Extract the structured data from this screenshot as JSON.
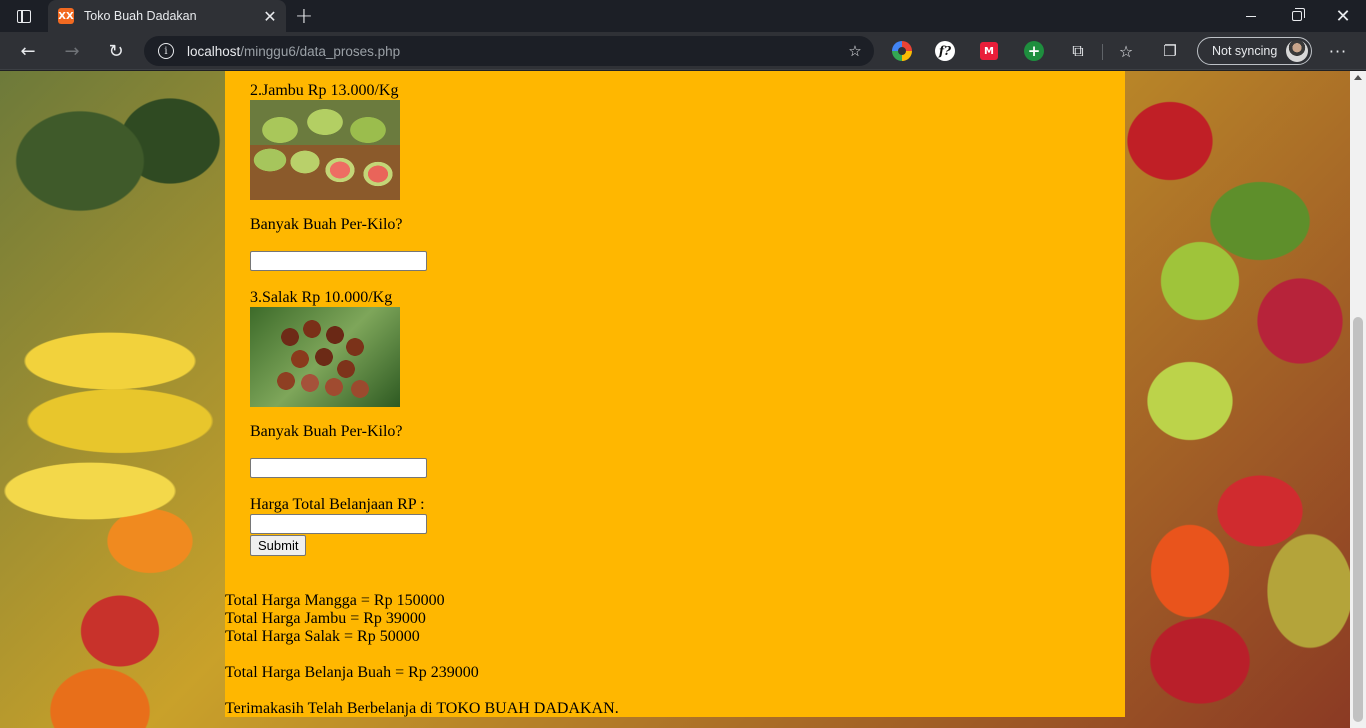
{
  "browser": {
    "tab_title": "Toko Buah Dadakan",
    "favicon_text": "XX",
    "url_host": "localhost",
    "url_path": "/minggu6/data_proses.php",
    "sync_label": "Not syncing"
  },
  "form": {
    "item2_label": "2.Jambu Rp 13.000/Kg",
    "item3_label": "3.Salak Rp 10.000/Kg",
    "qty_question_2": "Banyak Buah Per-Kilo?",
    "qty_question_3": "Banyak Buah Per-Kilo?",
    "qty_value_2": "",
    "qty_value_3": "",
    "total_label": "Harga Total Belanjaan RP :",
    "total_value": "",
    "submit_label": "Submit"
  },
  "results": {
    "mangga": "Total Harga Mangga = Rp 150000",
    "jambu": "Total Harga Jambu = Rp 39000",
    "salak": "Total Harga Salak = Rp 50000",
    "grand_total": "Total Harga Belanja Buah = Rp 239000",
    "thanks": "Terimakasih Telah Berbelanja di TOKO BUAH DADAKAN."
  },
  "colors": {
    "content_bg": "#ffb700"
  }
}
